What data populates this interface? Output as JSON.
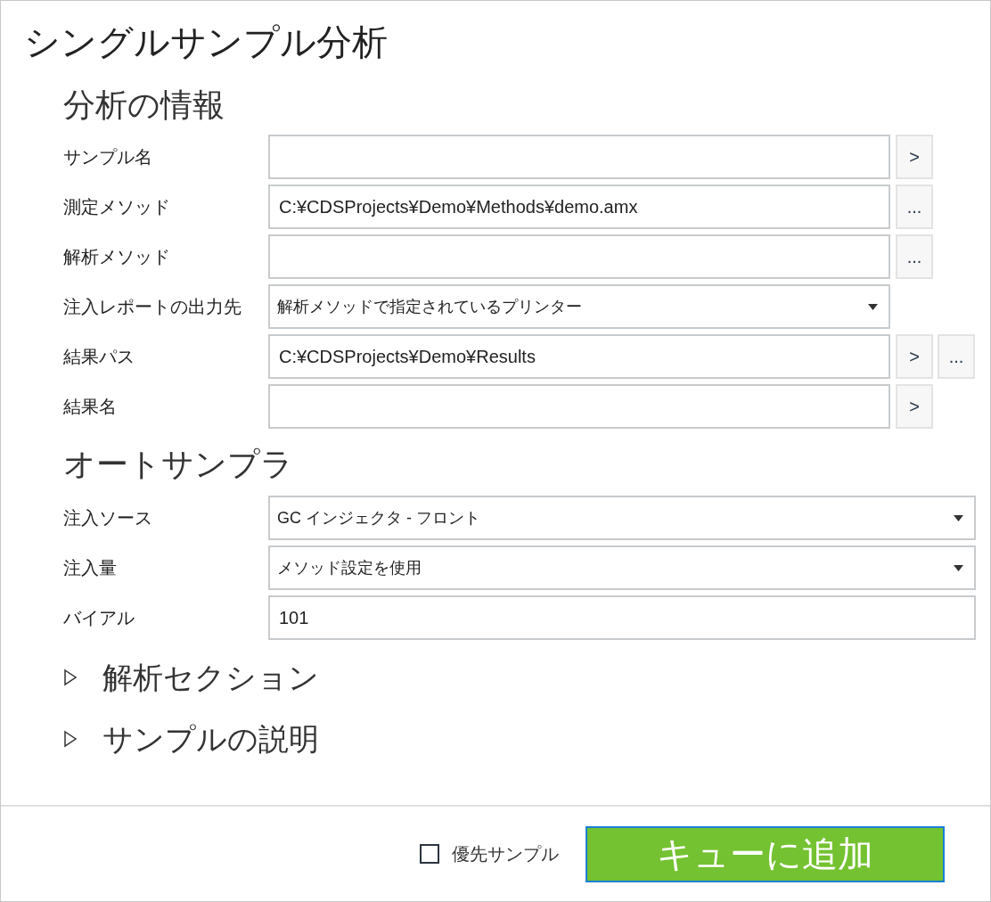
{
  "title": "シングルサンプル分析",
  "sections": [
    {
      "title": "分析の情報",
      "fields": [
        {
          "label": "サンプル名",
          "kind": "text",
          "buttons": [
            ">"
          ]
        },
        {
          "label": "測定メソッド",
          "kind": "text",
          "value": "C:¥CDSProjects¥Demo¥Methods¥demo.amx",
          "buttons": [
            "..."
          ]
        },
        {
          "label": "解析メソッド",
          "kind": "text",
          "buttons": [
            "..."
          ]
        },
        {
          "label": "注入レポートの出力先",
          "kind": "select",
          "value": "解析メソッドで指定されているプリンター"
        },
        {
          "label": "結果パス",
          "kind": "text",
          "value": "C:¥CDSProjects¥Demo¥Results",
          "buttons": [
            ">",
            "..."
          ]
        },
        {
          "label": "結果名",
          "kind": "text",
          "buttons": [
            ">"
          ]
        }
      ]
    },
    {
      "title": "オートサンプラ",
      "fields": [
        {
          "label": "注入ソース",
          "kind": "select",
          "value": "GC インジェクタ - フロント"
        },
        {
          "label": "注入量",
          "kind": "select",
          "value": "メソッド設定を使用"
        },
        {
          "label": "バイアル",
          "kind": "text",
          "value": "101"
        }
      ]
    }
  ],
  "collapsibles": [
    {
      "title": "解析セクション",
      "expanded": false
    },
    {
      "title": "サンプルの説明",
      "expanded": false
    }
  ],
  "priority": {
    "label": "優先サンプル",
    "checked": false
  },
  "submit": "キューに追加"
}
